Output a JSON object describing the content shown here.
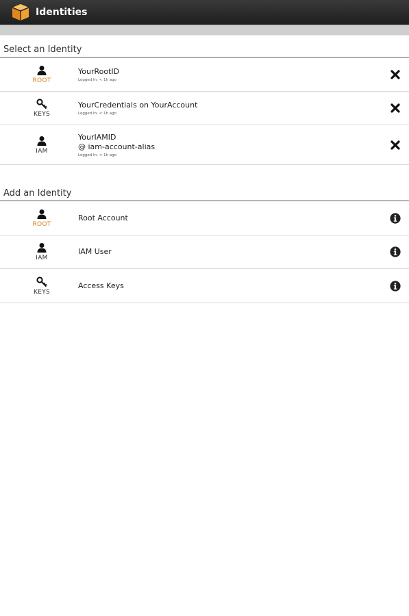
{
  "actionbar": {
    "title": "Identities"
  },
  "select_section": {
    "header": "Select an Identity",
    "items": [
      {
        "type_label": "ROOT",
        "icon": "person-icon",
        "name": "YourRootID",
        "alias": "",
        "meta": "Logged In: < 1h ago"
      },
      {
        "type_label": "KEYS",
        "icon": "key-icon",
        "name": "YourCredentials on YourAccount",
        "alias": "",
        "meta": "Logged In: < 1h ago"
      },
      {
        "type_label": "IAM",
        "icon": "person-icon",
        "name": "YourIAMID",
        "alias": "@ iam-account-alias",
        "meta": "Logged In: < 1h ago"
      }
    ]
  },
  "add_section": {
    "header": "Add an Identity",
    "items": [
      {
        "type_label": "ROOT",
        "icon": "person-icon",
        "name": "Root Account"
      },
      {
        "type_label": "IAM",
        "icon": "person-icon",
        "name": "IAM User"
      },
      {
        "type_label": "KEYS",
        "icon": "key-icon",
        "name": "Access Keys"
      }
    ]
  },
  "colors": {
    "root_label": "#d5821c",
    "action_bar": "#2b2b2b",
    "app_icon": "#f0a030"
  }
}
